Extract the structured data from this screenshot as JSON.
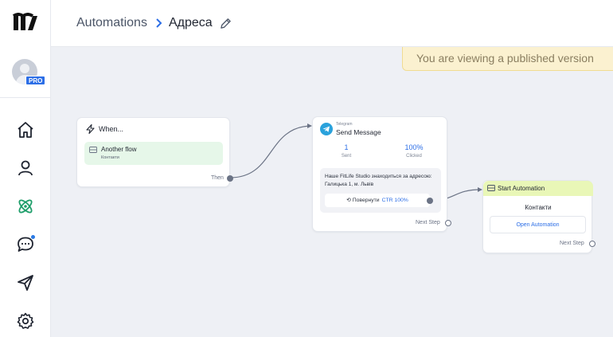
{
  "header": {
    "breadcrumb_root": "Automations",
    "breadcrumb_current": "Адреса"
  },
  "banner": {
    "text": "You are viewing a published version"
  },
  "sidebar": {
    "badge": "PRO",
    "items": [
      {
        "icon": "home-icon"
      },
      {
        "icon": "user-icon"
      },
      {
        "icon": "automation-icon",
        "active": true
      },
      {
        "icon": "chat-icon",
        "has_notification": true
      },
      {
        "icon": "send-icon"
      },
      {
        "icon": "gear-icon"
      }
    ]
  },
  "nodes": {
    "trigger": {
      "title": "When...",
      "item_title": "Another flow",
      "item_subtitle": "Контакти",
      "port_label": "Then"
    },
    "telegram": {
      "channel": "Telegram",
      "title": "Send Message",
      "sent_value": "1",
      "sent_label": "Sent",
      "clicked_value": "100%",
      "clicked_label": "Clicked",
      "message": "Наше FitLife Studio знаходиться за адресою: Галицька 1, м. Львів",
      "button_label": "⟲ Повернути",
      "button_ctr": "CTR 100%",
      "port_label": "Next Step"
    },
    "start_automation": {
      "title": "Start Automation",
      "flow_name": "Контакти",
      "button_label": "Open Automation",
      "port_label": "Next Step"
    }
  },
  "colors": {
    "accent": "#2c6ee6",
    "trigger_bg": "#e6f7e9",
    "start_header_bg": "#e9f7b7",
    "banner_bg": "#fbf1d0",
    "active_nav": "#1e9e6a"
  }
}
